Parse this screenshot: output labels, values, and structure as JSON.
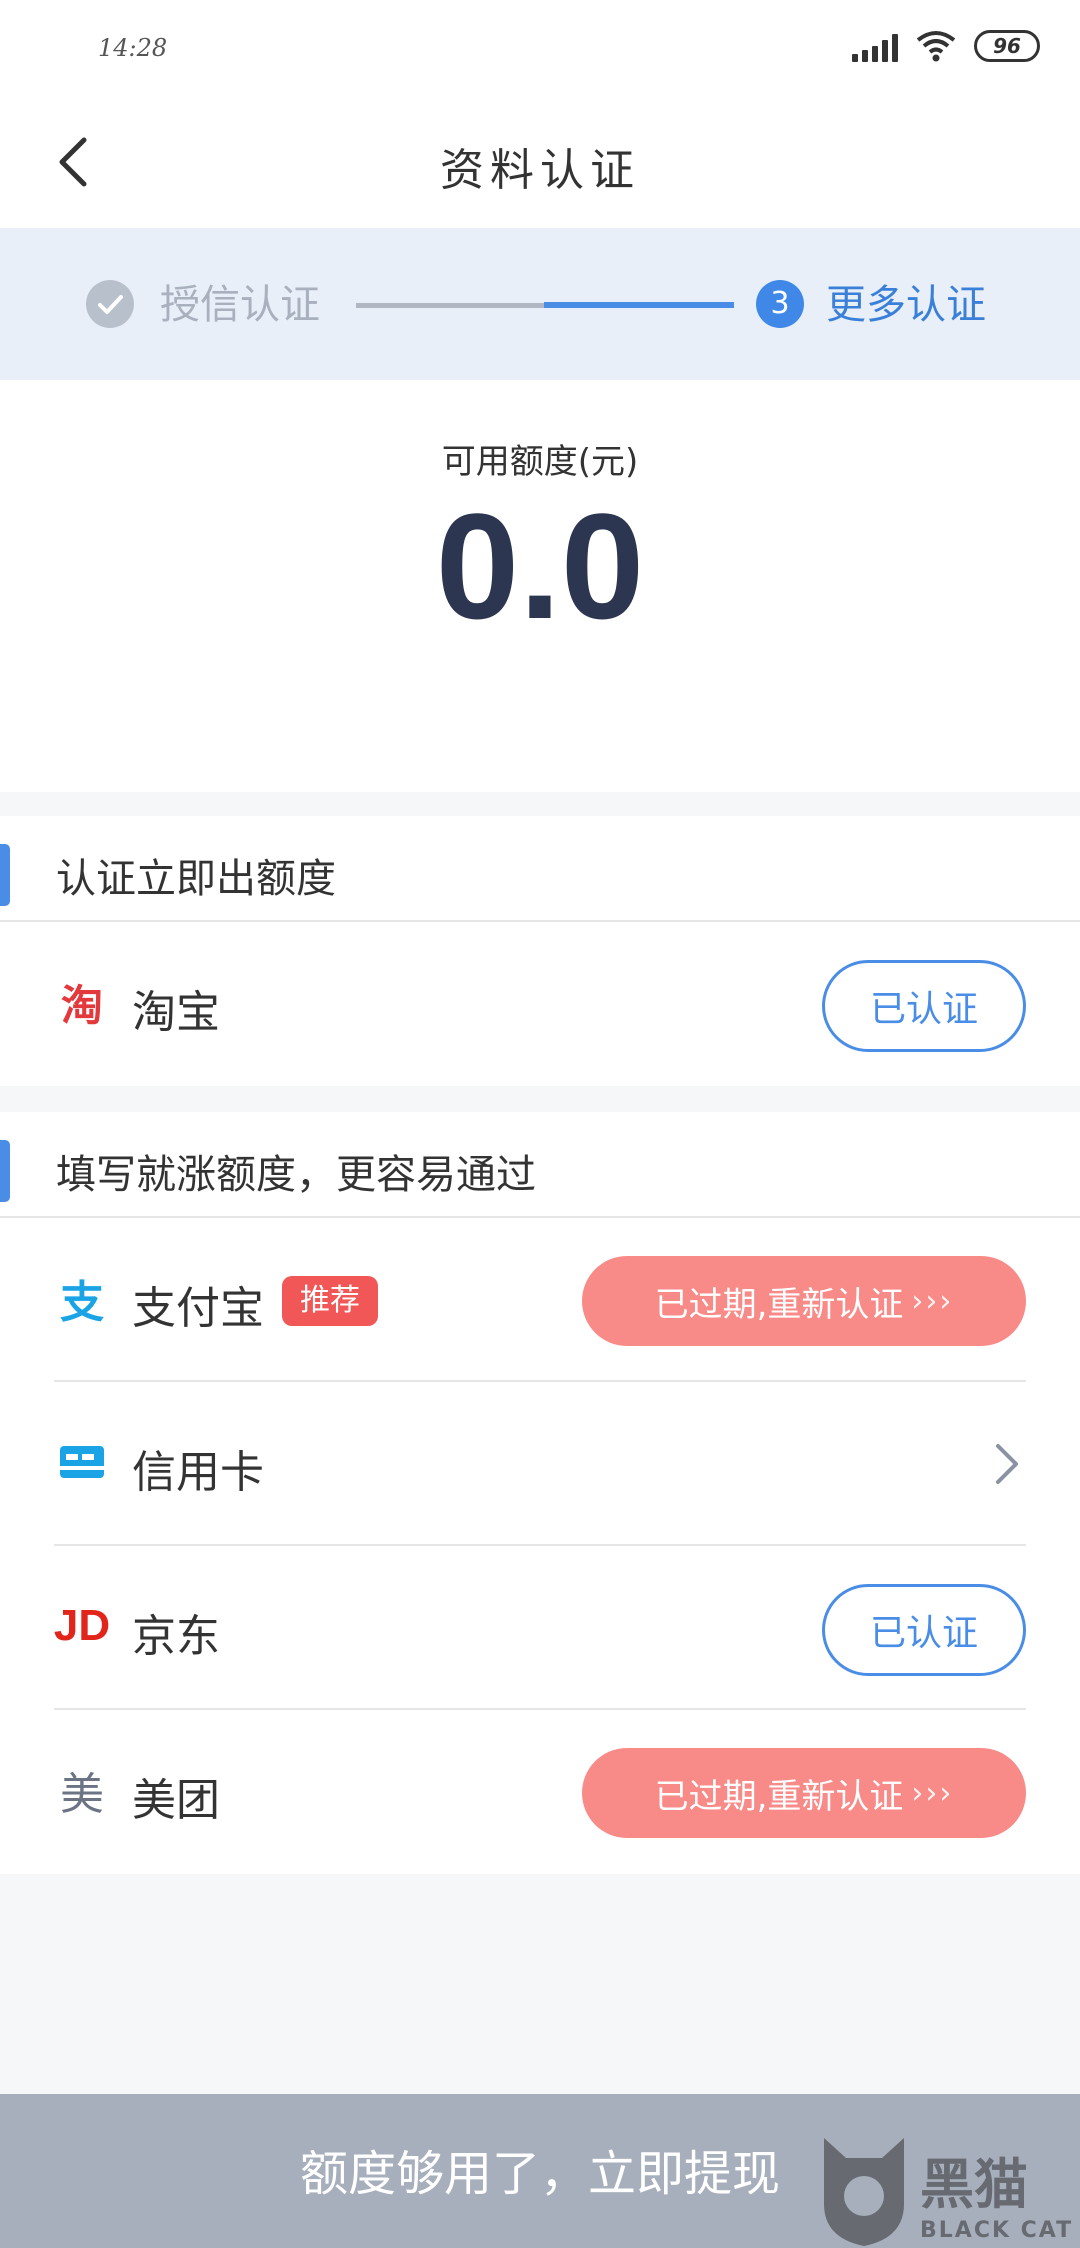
{
  "status_bar": {
    "time": "14:28",
    "battery": "96"
  },
  "nav": {
    "title": "资料认证"
  },
  "progress": {
    "step1_label": "授信认证",
    "step3_number": "3",
    "step3_label": "更多认证"
  },
  "amount": {
    "label": "可用额度(元)",
    "value": "0.0"
  },
  "section1": {
    "title": "认证立即出额度",
    "items": [
      {
        "icon": "taobao-icon",
        "label": "淘宝",
        "status": "已认证"
      }
    ]
  },
  "section2": {
    "title": "填写就涨额度，更容易通过",
    "items": [
      {
        "icon": "alipay-icon",
        "label": "支付宝",
        "badge": "推荐",
        "status": "已过期,重新认证"
      },
      {
        "icon": "credit-card-icon",
        "label": "信用卡"
      },
      {
        "icon": "jd-icon",
        "label": "京东",
        "status": "已认证"
      },
      {
        "icon": "meituan-icon",
        "label": "美团",
        "status": "已过期,重新认证"
      }
    ]
  },
  "bottom": {
    "button_label": "额度够用了，立即提现"
  },
  "watermark": {
    "text": "黑猫",
    "sub": "BLACK CAT"
  },
  "colors": {
    "accent": "#4a8de6",
    "expired": "#f88a88",
    "badge": "#f15757",
    "progress_bg": "#e8eff9"
  }
}
